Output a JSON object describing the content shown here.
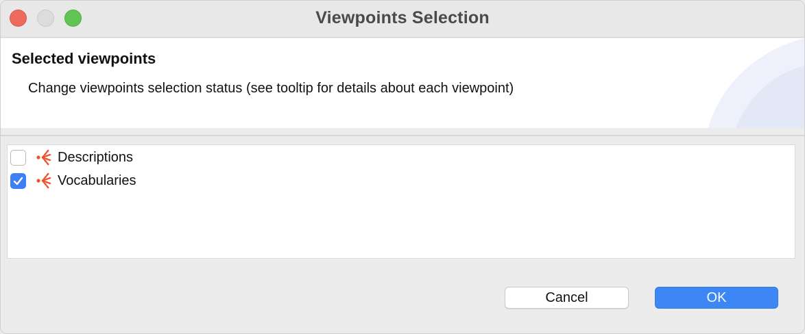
{
  "window": {
    "title": "Viewpoints Selection"
  },
  "header": {
    "title": "Selected viewpoints",
    "description": "Change viewpoints selection status (see tooltip for details about each viewpoint)"
  },
  "viewpoints": [
    {
      "label": "Descriptions",
      "checked": false,
      "icon": "viewpoint-icon"
    },
    {
      "label": "Vocabularies",
      "checked": true,
      "icon": "viewpoint-icon"
    }
  ],
  "buttons": {
    "cancel_label": "Cancel",
    "ok_label": "OK"
  },
  "colors": {
    "accent": "#3d86f6",
    "icon": "#e8552c"
  }
}
